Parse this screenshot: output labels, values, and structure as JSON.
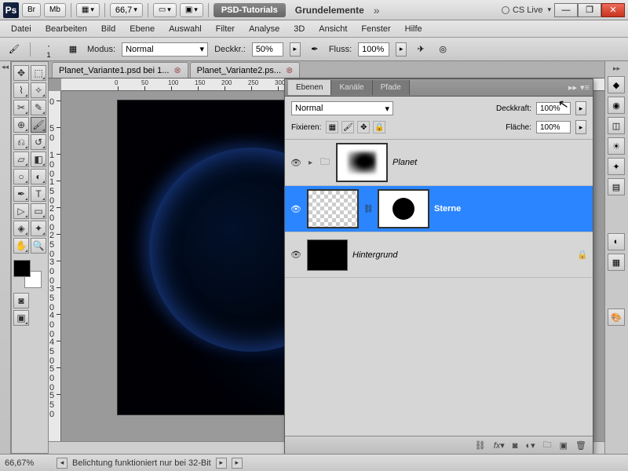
{
  "app": {
    "logo": "Ps",
    "br": "Br",
    "mb": "Mb",
    "zoom": "66,7",
    "workspace": "PSD-Tutorials",
    "document": "Grundelemente",
    "cslive": "CS Live"
  },
  "menu": [
    "Datei",
    "Bearbeiten",
    "Bild",
    "Ebene",
    "Auswahl",
    "Filter",
    "Analyse",
    "3D",
    "Ansicht",
    "Fenster",
    "Hilfe"
  ],
  "options": {
    "modus_label": "Modus:",
    "modus_value": "Normal",
    "deckk_label": "Deckkr.:",
    "deckk_value": "50%",
    "fluss_label": "Fluss:",
    "fluss_value": "100%",
    "brush_size": "1"
  },
  "tabs": [
    {
      "label": "Planet_Variante1.psd bei 1..."
    },
    {
      "label": "Planet_Variante2.ps..."
    }
  ],
  "ruler_h": [
    0,
    50,
    100,
    150,
    200,
    250,
    300
  ],
  "ruler_v": [
    0,
    50,
    100,
    150,
    200,
    250,
    300,
    350,
    400,
    450,
    500,
    550
  ],
  "layers_panel": {
    "tabs": [
      "Ebenen",
      "Kanäle",
      "Pfade"
    ],
    "blend": "Normal",
    "deckk_label": "Deckkraft:",
    "deckk_value": "100%",
    "fix_label": "Fixieren:",
    "flaeche_label": "Fläche:",
    "flaeche_value": "100%",
    "layers": [
      {
        "name": "Planet"
      },
      {
        "name": "Sterne"
      },
      {
        "name": "Hintergrund"
      }
    ]
  },
  "status": {
    "zoom": "66,67%",
    "msg": "Belichtung funktioniert nur bei 32-Bit"
  }
}
